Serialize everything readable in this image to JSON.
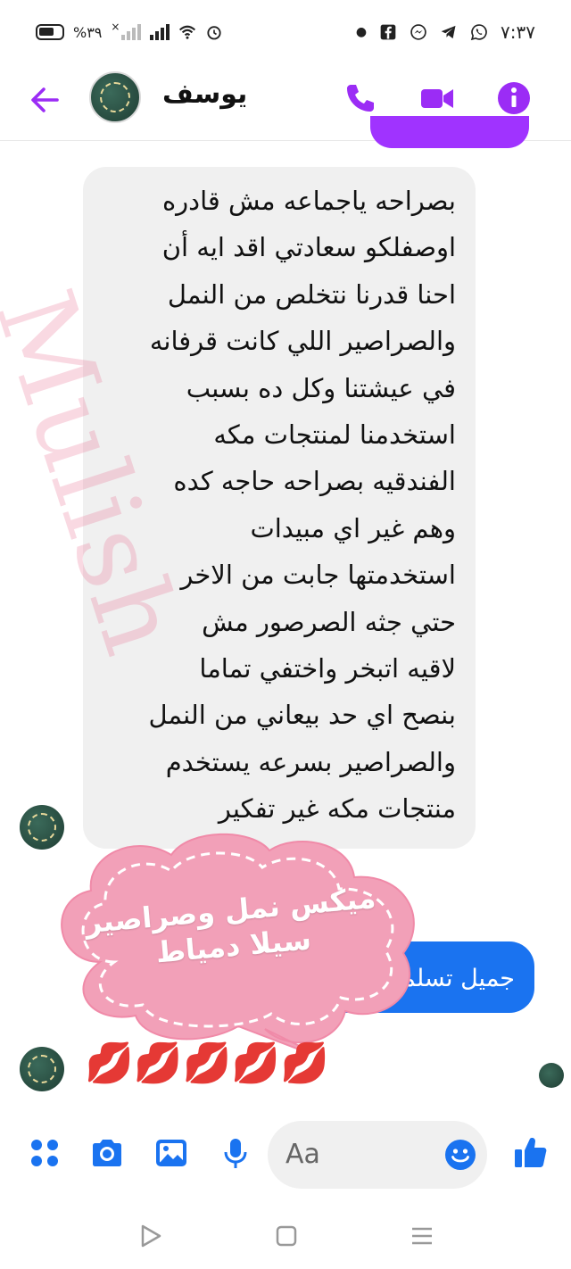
{
  "status_bar": {
    "time": "٧:٣٧",
    "battery": "%٣٩",
    "signal_x": "×"
  },
  "header": {
    "contact_name": "يوسف"
  },
  "colors": {
    "accent_purple": "#a033ff",
    "sent_blue": "#1a73f0",
    "received_gray": "#f0f0f0",
    "sticker_pink": "#f2a0b8"
  },
  "messages": {
    "received_lines": [
      "بصراحه ياجماعه مش قادره",
      "اوصفلكو سعادتي اقد ايه أن",
      "احنا قدرنا نتخلص من النمل",
      "والصراصير اللي كانت قرفانه",
      "في عيشتنا  وكل ده بسبب",
      "استخدمنا لمنتجات مكه",
      "الفندقيه بصراحه حاجه كده",
      "وهم غير اي مبيدات",
      "استخدمتها جابت من الاخر",
      "حتي جثه الصرصور مش",
      "لاقيه اتبخر واختفي تماما",
      "بنصح اي حد بيعاني من النمل",
      "والصراصير بسرعه يستخدم",
      "منتجات مكه غير تفكير"
    ],
    "watermark": "Mulish",
    "sent_text": "جميل تسلمي",
    "sticker_lines": [
      "ميكس نمل وصراصير",
      "سيلا دمياط"
    ],
    "kisses": "💋💋💋💋💋"
  },
  "composer": {
    "placeholder": "Aa"
  },
  "icons": {
    "back": "back-arrow-icon",
    "call": "phone-icon",
    "video": "video-camera-icon",
    "info": "info-icon",
    "apps": "apps-grid-icon",
    "camera": "camera-icon",
    "gallery": "image-icon",
    "mic": "microphone-icon",
    "emoji": "emoji-icon",
    "like": "thumbs-up-icon"
  }
}
